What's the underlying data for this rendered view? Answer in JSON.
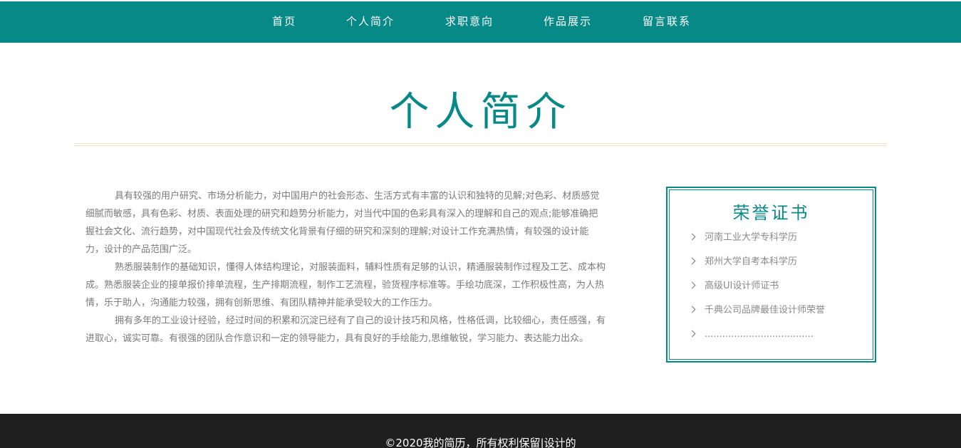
{
  "nav": {
    "items": [
      {
        "label": "首页"
      },
      {
        "label": "个人简介"
      },
      {
        "label": "求职意向"
      },
      {
        "label": "作品展示"
      },
      {
        "label": "留言联系"
      }
    ]
  },
  "section": {
    "title": "个人简介"
  },
  "intro": {
    "paragraphs": [
      "具有较强的用户研究、市场分析能力，对中国用户的社会形态、生活方式有丰富的认识和独特的见解;对色彩、材质感觉细腻而敏感，具有色彩、材质、表面处理的研究和趋势分析能力，对当代中国的色彩具有深入的理解和自己的观点;能够准确把握社会文化、流行趋势，对中国现代社会及传统文化背景有仔细的研究和深刻的理解;对设计工作充满热情，有较强的设计能力，设计的产品范围广泛。",
      "熟悉服装制作的基础知识，懂得人体结构理论，对服装面料，辅料性质有足够的认识，精通服装制作过程及工艺、成本构成。熟悉服装企业的接单报价排单流程，生产排期流程，制作工艺流程，验货程序标准等。手绘功底深，工作积极性高，为人热情，乐于助人，沟通能力较强，拥有创新思维、有团队精神并能承受较大的工作压力。",
      "拥有多年的工业设计经验，经过时间的积累和沉淀已经有了自己的设计技巧和风格，性格低调，比较细心，责任感强，有进取心，诚实可靠。有很强的团队合作意识和一定的领导能力，具有良好的手绘能力,思维敏锐，学习能力、表达能力出众。"
    ]
  },
  "certificates": {
    "title": "荣誉证书",
    "items": [
      "河南工业大学专科学历",
      "郑州大学自考本科学历",
      "高级UI设计师证书",
      "千典公司品牌最佳设计师荣誉",
      "....................................."
    ]
  },
  "footer": {
    "text": "©2020我的简历，所有权利保留|设计的"
  },
  "colors": {
    "accent": "#078a87",
    "footer_bg": "#1f1f1f",
    "body_text": "#7a7a7a"
  }
}
